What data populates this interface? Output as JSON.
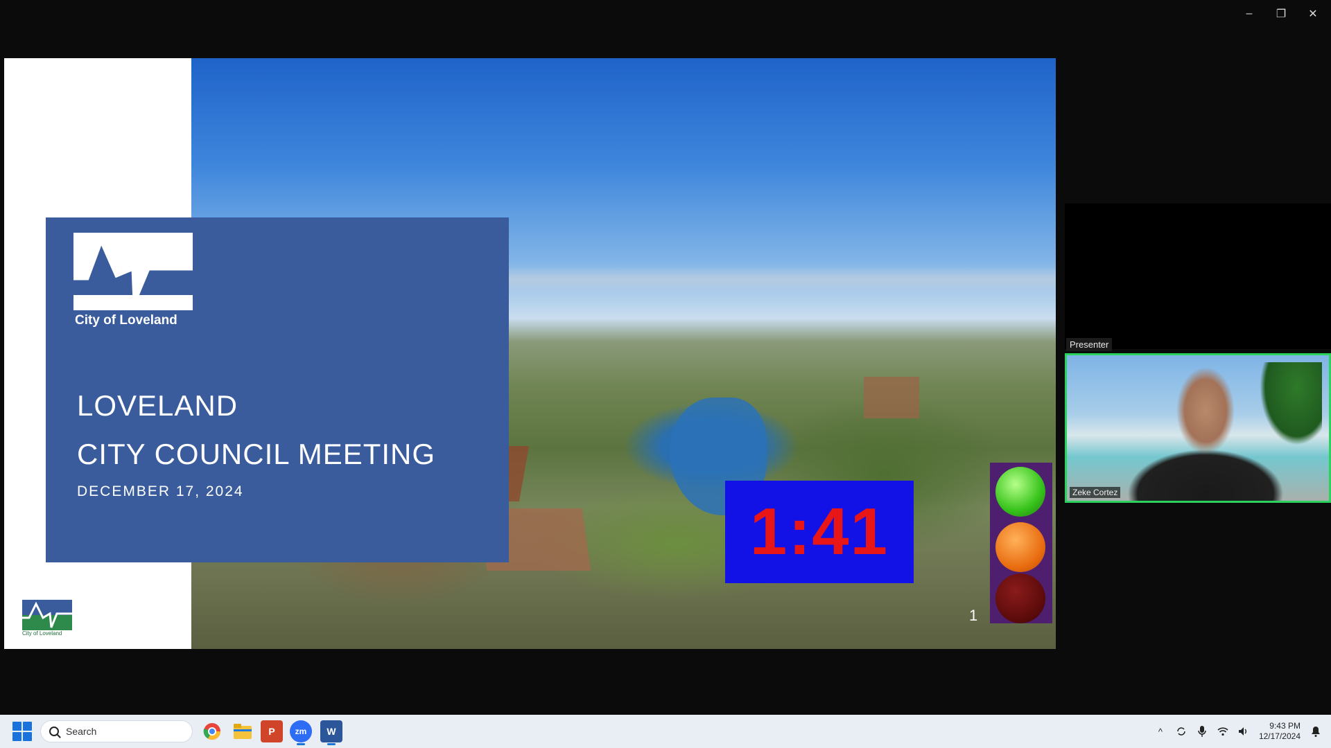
{
  "window": {
    "controls": {
      "minimize": "–",
      "restore": "❐",
      "close": "✕"
    }
  },
  "slide": {
    "logo_text": "City of Loveland",
    "title_line_1": "LOVELAND",
    "title_line_2": "CITY COUNCIL MEETING",
    "date": "DECEMBER 17, 2024",
    "small_logo_text": "City of Loveland",
    "timer": "1:41",
    "slide_number": "1",
    "colors": {
      "card": "#3a5c9c",
      "timer_bg": "#1212e6",
      "timer_text": "#e81616",
      "light_panel": "#4d1f6e"
    }
  },
  "video": {
    "presenter_label": "Presenter",
    "participant_name": "Zeke Cortez",
    "active_border_color": "#2bd35e"
  },
  "taskbar": {
    "search_label": "Search",
    "apps": [
      {
        "name": "chrome-icon",
        "glyph": "",
        "color": "#e8453c"
      },
      {
        "name": "file-explorer-icon",
        "glyph": "",
        "color": "#f5c33b"
      },
      {
        "name": "powerpoint-icon",
        "glyph": "P",
        "color": "#d0452a"
      },
      {
        "name": "zoom-icon",
        "glyph": "zm",
        "color": "#2d6cf5"
      },
      {
        "name": "word-icon",
        "glyph": "W",
        "color": "#2b579a"
      }
    ],
    "tray": {
      "chevron": "^",
      "time": "9:43 PM",
      "date": "12/17/2024"
    }
  }
}
